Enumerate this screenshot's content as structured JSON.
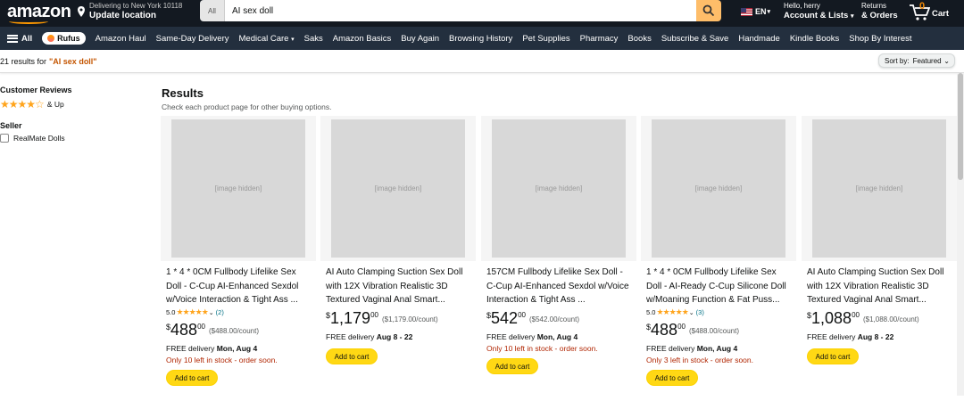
{
  "header": {
    "logo": "amazon",
    "deliver_line1": "Delivering to New York 10118",
    "deliver_line2": "Update location",
    "search_category": "All",
    "search_value": "AI sex doll",
    "lang": "EN",
    "account_line1": "Hello, herry",
    "account_line2": "Account & Lists",
    "returns_line1": "Returns",
    "returns_line2": "& Orders",
    "cart_count": "0",
    "cart_label": "Cart",
    "colors": {
      "nav_top": "#131921",
      "nav_sub": "#232f3e",
      "search_button": "#febd69",
      "accent": "#ff9900"
    }
  },
  "subnav": {
    "all": "All",
    "rufus": "Rufus",
    "items": [
      "Amazon Haul",
      "Same-Day Delivery",
      "Medical Care",
      "Saks",
      "Amazon Basics",
      "Buy Again",
      "Browsing History",
      "Pet Supplies",
      "Pharmacy",
      "Books",
      "Subscribe & Save",
      "Handmade",
      "Kindle Books",
      "Shop By Interest"
    ]
  },
  "results_bar": {
    "count_text": "21 results for ",
    "query": "\"AI sex doll\"",
    "sort_label": "Sort by:",
    "sort_value": "Featured"
  },
  "sidebar": {
    "reviews_heading": "Customer Reviews",
    "reviews_stars": "★★★★☆",
    "reviews_up": "& Up",
    "seller_heading": "Seller",
    "seller_option": "RealMate Dolls"
  },
  "results": {
    "title": "Results",
    "subtitle": "Check each product page for other buying options.",
    "image_placeholder": "[image hidden]",
    "products": [
      {
        "title": "1 * 4 * 0CM Fullbody Lifelike Sex Doll - C-Cup AI-Enhanced Sexdol w/Voice Interaction & Tight Ass ...",
        "rating": "5.0",
        "stars": "★★★★★",
        "reviews": "(2)",
        "currency": "$",
        "whole": "488",
        "fraction": "00",
        "unit": "($488.00/count)",
        "delivery_label": "FREE delivery ",
        "delivery_date": "Mon, Aug 4",
        "stock": "Only 10 left in stock - order soon.",
        "cta": "Add to cart"
      },
      {
        "title": "AI Auto Clamping Suction Sex Doll with 12X Vibration Realistic 3D Textured Vaginal Anal Smart...",
        "rating": "",
        "stars": "",
        "reviews": "",
        "currency": "$",
        "whole": "1,179",
        "fraction": "00",
        "unit": "($1,179.00/count)",
        "delivery_label": "FREE delivery ",
        "delivery_date": "Aug 8 - 22",
        "stock": "",
        "cta": "Add to cart"
      },
      {
        "title": "157CM Fullbody Lifelike Sex Doll - C-Cup AI-Enhanced Sexdol w/Voice Interaction & Tight Ass ...",
        "rating": "",
        "stars": "",
        "reviews": "",
        "currency": "$",
        "whole": "542",
        "fraction": "00",
        "unit": "($542.00/count)",
        "delivery_label": "FREE delivery ",
        "delivery_date": "Mon, Aug 4",
        "stock": "Only 10 left in stock - order soon.",
        "cta": "Add to cart"
      },
      {
        "title": "1 * 4 * 0CM Fullbody Lifelike Sex Doll - AI-Ready C-Cup Silicone Doll w/Moaning Function & Fat Puss...",
        "rating": "5.0",
        "stars": "★★★★★",
        "reviews": "(3)",
        "currency": "$",
        "whole": "488",
        "fraction": "00",
        "unit": "($488.00/count)",
        "delivery_label": "FREE delivery ",
        "delivery_date": "Mon, Aug 4",
        "stock": "Only 3 left in stock - order soon.",
        "cta": "Add to cart"
      },
      {
        "title": "AI Auto Clamping Suction Sex Doll with 12X Vibration Realistic 3D Textured Vaginal Anal Smart...",
        "rating": "",
        "stars": "",
        "reviews": "",
        "currency": "$",
        "whole": "1,088",
        "fraction": "00",
        "unit": "($1,088.00/count)",
        "delivery_label": "FREE delivery ",
        "delivery_date": "Aug 8 - 22",
        "stock": "",
        "cta": "Add to cart"
      }
    ]
  }
}
